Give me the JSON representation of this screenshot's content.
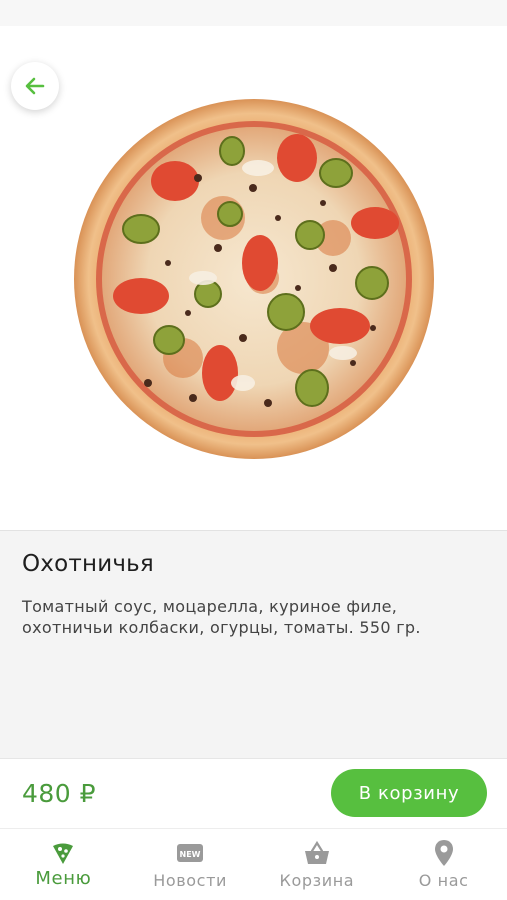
{
  "product": {
    "name": "Охотничья",
    "description": "Томатный соус, моцарелла, куриное филе, охотничьи колбаски, огурцы, томаты. 550 гр.",
    "price": "480 ₽",
    "image_icon": "pizza-photo"
  },
  "header": {
    "back_icon": "arrow-left-icon"
  },
  "actions": {
    "add_to_cart_label": "В корзину"
  },
  "tabs": [
    {
      "label": "Меню",
      "icon": "pizza-slice-icon",
      "active": true
    },
    {
      "label": "Новости",
      "icon": "new-badge-icon",
      "active": false
    },
    {
      "label": "Корзина",
      "icon": "basket-icon",
      "active": false
    },
    {
      "label": "О нас",
      "icon": "location-pin-icon",
      "active": false
    }
  ],
  "colors": {
    "accent": "#57bf3f",
    "accent_text": "#4a9b3c",
    "inactive": "#9a9a9a",
    "info_bg": "#f4f4f4"
  }
}
